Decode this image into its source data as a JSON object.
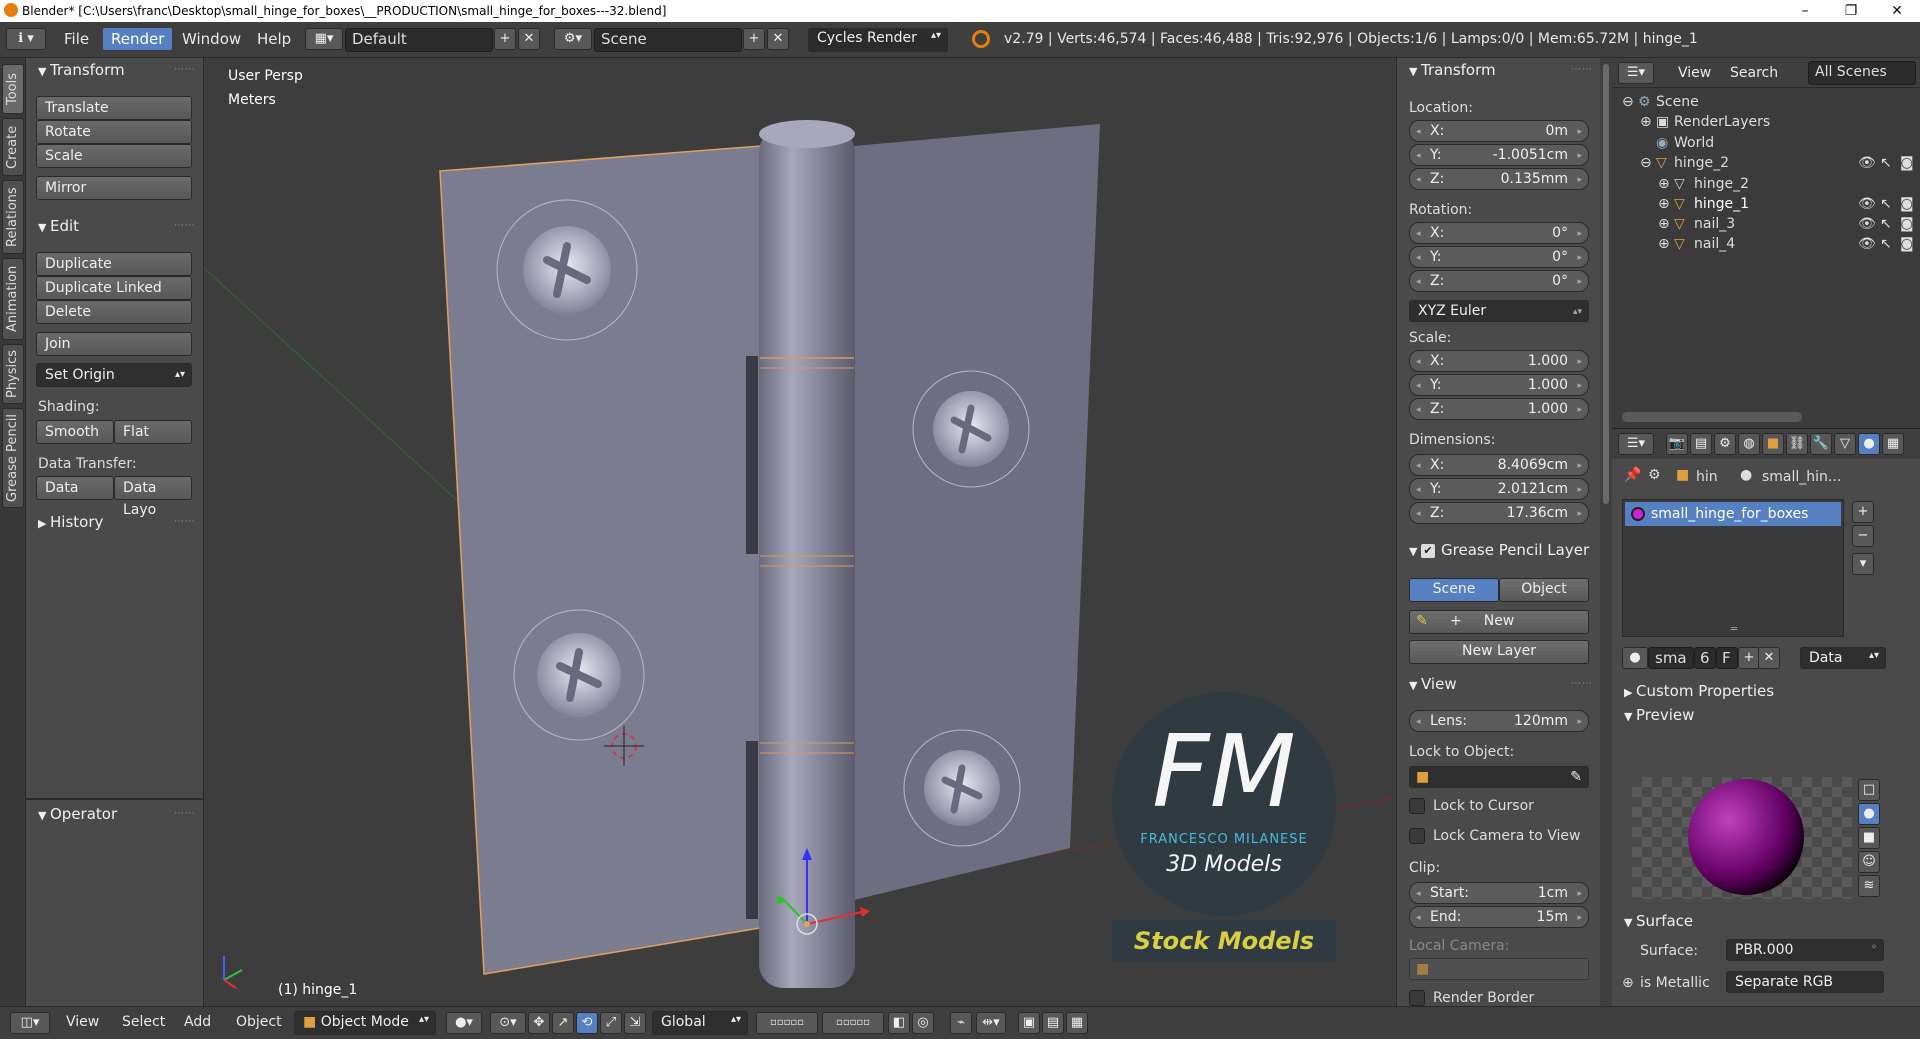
{
  "window": {
    "title": "Blender* [C:\\Users\\franc\\Desktop\\small_hinge_for_boxes\\__PRODUCTION\\small_hinge_for_boxes---32.blend]",
    "controls": [
      "–",
      "❐",
      "✕"
    ]
  },
  "menubar": {
    "menus": [
      "File",
      "Render",
      "Window",
      "Help"
    ],
    "active_menu": "Render",
    "layout": "Default",
    "scene": "Scene",
    "engine": "Cycles Render",
    "stats": "v2.79 | Verts:46,574 | Faces:46,488 | Tris:92,976 | Objects:1/6 | Lamps:0/0 | Mem:65.72M | hinge_1"
  },
  "side_tabs": [
    "Tools",
    "Create",
    "Relations",
    "Animation",
    "Physics",
    "Grease Pencil"
  ],
  "toolshelf": {
    "transform_title": "Transform",
    "transform_buttons": [
      "Translate",
      "Rotate",
      "Scale",
      "Mirror"
    ],
    "edit_title": "Edit",
    "edit_buttons": [
      "Duplicate",
      "Duplicate Linked",
      "Delete",
      "Join"
    ],
    "set_origin": "Set Origin",
    "shading_label": "Shading:",
    "smooth": "Smooth",
    "flat": "Flat",
    "data_transfer_label": "Data Transfer:",
    "data": "Data",
    "data_layout": "Data Layo",
    "history": "History",
    "operator": "Operator"
  },
  "viewport": {
    "view_name": "User Persp",
    "units": "Meters",
    "active_object": "(1) hinge_1",
    "logo_letters": "FM",
    "logo_name": "FRANCESCO MILANESE",
    "logo_subtitle": "3D Models",
    "stock_label": "Stock Models"
  },
  "npanel": {
    "transform_title": "Transform",
    "location_label": "Location:",
    "location": [
      {
        "k": "X:",
        "v": "0m"
      },
      {
        "k": "Y:",
        "v": "-1.0051cm"
      },
      {
        "k": "Z:",
        "v": "0.135mm"
      }
    ],
    "rotation_label": "Rotation:",
    "rotation": [
      {
        "k": "X:",
        "v": "0°"
      },
      {
        "k": "Y:",
        "v": "0°"
      },
      {
        "k": "Z:",
        "v": "0°"
      }
    ],
    "rotation_mode": "XYZ Euler",
    "scale_label": "Scale:",
    "scale": [
      {
        "k": "X:",
        "v": "1.000"
      },
      {
        "k": "Y:",
        "v": "1.000"
      },
      {
        "k": "Z:",
        "v": "1.000"
      }
    ],
    "dimensions_label": "Dimensions:",
    "dimensions": [
      {
        "k": "X:",
        "v": "8.4069cm"
      },
      {
        "k": "Y:",
        "v": "2.0121cm"
      },
      {
        "k": "Z:",
        "v": "17.36cm"
      }
    ],
    "grease_pencil_title": "Grease Pencil Layer",
    "gp_scene": "Scene",
    "gp_object": "Object",
    "gp_new": "New",
    "gp_new_layer": "New Layer",
    "view_title": "View",
    "lens_label": "Lens:",
    "lens_value": "120mm",
    "lock_to_object": "Lock to Object:",
    "lock_to_cursor": "Lock to Cursor",
    "lock_camera": "Lock Camera to View",
    "clip_label": "Clip:",
    "clip_start_label": "Start:",
    "clip_start": "1cm",
    "clip_end_label": "End:",
    "clip_end": "15m",
    "local_camera": "Local Camera:",
    "render_border": "Render Border"
  },
  "outliner": {
    "header": {
      "view": "View",
      "search": "Search",
      "filter": "All Scenes"
    },
    "items": [
      "Scene",
      "RenderLayers",
      "World",
      "hinge_2",
      "hinge_2",
      "hinge_1",
      "nail_3",
      "nail_4"
    ]
  },
  "properties": {
    "breadcrumb_obj": "hin",
    "breadcrumb_mat": "small_hin...",
    "material_slot": "small_hinge_for_boxes",
    "mat_short": "sma",
    "users": "6",
    "fake": "F",
    "link_mode": "Data",
    "custom_properties": "Custom Properties",
    "preview": "Preview",
    "surface_title": "Surface",
    "surface_label": "Surface:",
    "surface_value": "PBR.000",
    "is_metallic_label": "is Metallic",
    "is_metallic_value": "Separate RGB"
  },
  "bottombar": {
    "menus": [
      "View",
      "Select",
      "Add",
      "Object"
    ],
    "mode": "Object Mode",
    "orientation": "Global"
  }
}
